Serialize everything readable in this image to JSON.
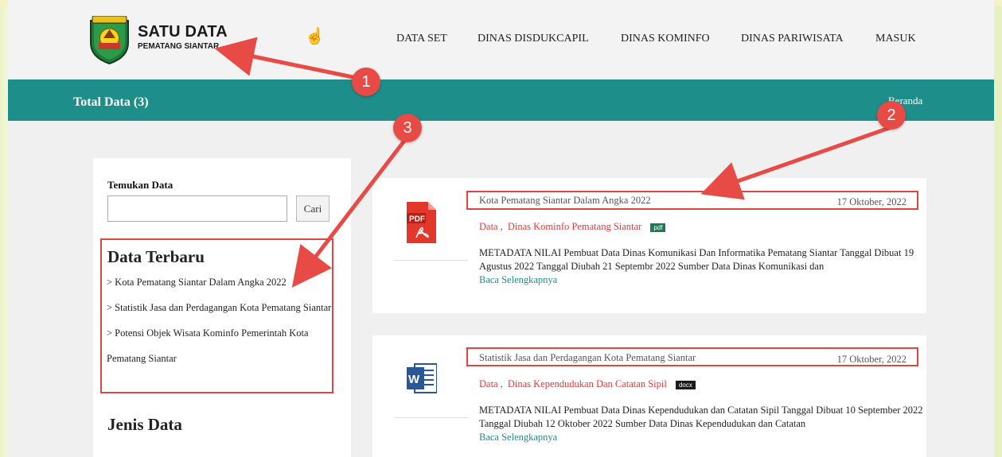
{
  "brand": {
    "title": "SATU DATA",
    "subtitle": "PEMATANG SIANTAR"
  },
  "nav": [
    "DATA SET",
    "DINAS DISDUKCAPIL",
    "DINAS KOMINFO",
    "DINAS PARIWISATA",
    "MASUK"
  ],
  "band": {
    "title": "Total Data (3)",
    "breadcrumb": "Beranda"
  },
  "sidebar": {
    "search_label": "Temukan Data",
    "search_value": "",
    "search_button": "Cari",
    "latest_heading": "Data Terbaru",
    "latest_items": [
      "> Kota Pematang Siantar Dalam Angka 2022",
      "> Statistik Jasa dan Perdagangan Kota Pematang Siantar",
      "> Potensi Objek Wisata Kominfo Pemerintah Kota Pematang Siantar"
    ],
    "types_heading": "Jenis Data"
  },
  "cards": [
    {
      "title": "Kota Pematang Siantar Dalam Angka 2022",
      "date": "17 Oktober, 2022",
      "category": "Data",
      "agency": "Dinas Kominfo Pematang Siantar",
      "format": "pdf",
      "icon": "pdf-file-icon",
      "description": "METADATA NILAI Pembuat Data Dinas Komunikasi Dan Informatika Pematang Siantar Tanggal Dibuat 19 Agustus 2022 Tanggal Diubah 21 Septembr 2022 Sumber Data Dinas Komunikasi dan",
      "read_more": "Baca Selengkapnya"
    },
    {
      "title": "Statistik Jasa dan Perdagangan Kota Pematang Siantar",
      "date": "17 Oktober, 2022",
      "category": "Data",
      "agency": "Dinas Kependudukan Dan Catatan Sipil",
      "format": "docx",
      "icon": "word-file-icon",
      "description": "METADATA NILAI Pembuat Data Dinas Kependudukan dan Catatan Sipil Tanggal Dibuat 10 September 2022 Tanggal Diubah 12 Oktober 2022 Sumber Data Dinas Kependudukan dan Catatan",
      "read_more": "Baca Selengkapnya"
    }
  ],
  "annotations": [
    "1",
    "2",
    "3"
  ],
  "colors": {
    "teal": "#1e8e8a",
    "annotation_red": "#e84b45",
    "category_red": "#e03a3a"
  }
}
